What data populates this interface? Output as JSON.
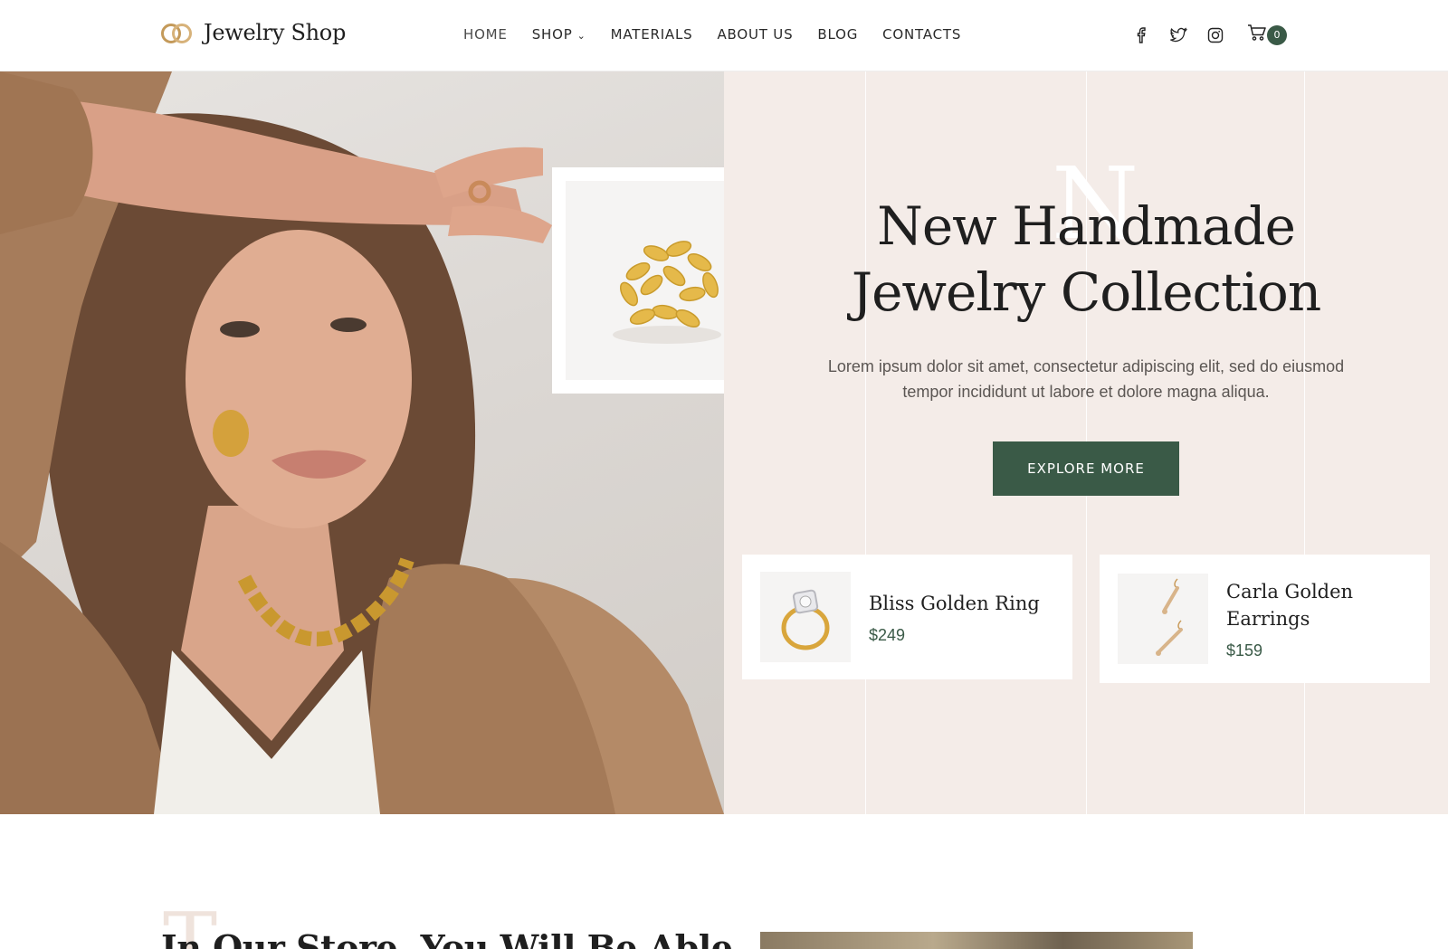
{
  "header": {
    "logo_text": "Jewelry Shop",
    "nav": [
      {
        "label": "HOME",
        "active": true
      },
      {
        "label": "SHOP",
        "has_dropdown": true
      },
      {
        "label": "MATERIALS"
      },
      {
        "label": "ABOUT US"
      },
      {
        "label": "BLOG"
      },
      {
        "label": "CONTACTS"
      }
    ],
    "social_icons": [
      "facebook-icon",
      "twitter-icon",
      "instagram-icon"
    ],
    "cart_count": "0"
  },
  "hero": {
    "decor_letter": "N",
    "title_line1": "New Handmade",
    "title_line2": "Jewelry Collection",
    "description": "Lorem ipsum dolor sit amet, consectetur adipiscing elit, sed do eiusmod tempor incididunt ut labore et dolore magna aliqua.",
    "cta_label": "EXPLORE MORE",
    "products": [
      {
        "name": "Bliss Golden Ring",
        "price": "$249"
      },
      {
        "name": "Carla Golden Earrings",
        "price": "$159"
      }
    ]
  },
  "section2": {
    "decor_letter": "T",
    "title": "In Our Store, You Will Be Able"
  },
  "colors": {
    "accent_green": "#3a5a47",
    "hero_bg": "#f4ece8",
    "logo_gold": "#c49a5a"
  }
}
